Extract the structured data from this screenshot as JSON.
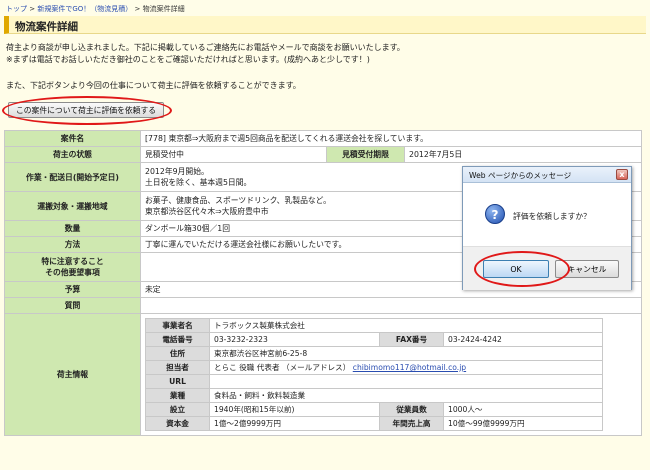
{
  "breadcrumb": {
    "items": [
      "トップ",
      "新規案件でGO！（物流見積）",
      "物流案件詳細"
    ],
    "separator": ">"
  },
  "page_title": "物流案件詳細",
  "intro": {
    "line1": "荷主より商談が申し込まれました。下記に掲載しているご連絡先にお電話やメールで商談をお願いいたします。",
    "line2": "※まずは電話でお話しいただき御社のことをご確認いただければと思います。(成約へあと少しです！)",
    "line3": "また、下記ボタンより今回の仕事について荷主に評価を依頼することができます。"
  },
  "request_button": "この案件について荷主に評価を依頼する",
  "details": {
    "case_name_label": "案件名",
    "case_name": "[778] 東京都⇒大阪府まで週5回商品を配送してくれる運送会社を探しています。",
    "status_label": "荷主の状態",
    "status": "見積受付中",
    "deadline_label": "見積受付期限",
    "deadline": "2012年7月5日",
    "work_period_label": "作業・配送日(開始予定日)",
    "work_period_1": "2012年9月開始。",
    "work_period_2": "土日祝を除く、基本週5日間。",
    "cargo_label": "運搬対象・運搬地域",
    "cargo_1": "お菓子、健康食品、スポーツドリンク、乳製品など。",
    "cargo_2": "東京都渋谷区代々木⇒大阪府豊中市",
    "quantity_label": "数量",
    "quantity": "ダンボール箱30個／1回",
    "method_label": "方法",
    "method": "丁寧に運んでいただける運送会社様にお願いしたいです。",
    "notes_label_1": "特に注意すること",
    "notes_label_2": "その他要望事項",
    "notes": "",
    "budget_label": "予算",
    "budget": "未定",
    "question_label": "質問",
    "question": "",
    "shipper_label": "荷主情報"
  },
  "shipper": {
    "company_label": "事業者名",
    "company": "トラボックス製菓株式会社",
    "phone_label": "電話番号",
    "phone": "03-3232-2323",
    "fax_label": "FAX番号",
    "fax": "03-2424-4242",
    "address_label": "住所",
    "address": "東京都渋谷区神宮前6-25-8",
    "contact_label": "担当者",
    "contact": "とらこ 役職 代表者 （メールアドレス）",
    "email": "chibimomo117@hotmail.co.jp",
    "url_label": "URL",
    "url": "",
    "industry_label": "業種",
    "industry": "食料品・飼料・飲料製造業",
    "founded_label": "設立",
    "founded": "1940年(昭和15年以前)",
    "employees_label": "従業員数",
    "employees": "1000人～",
    "capital_label": "資本金",
    "capital": "1億～2億9999万円",
    "sales_label": "年間売上高",
    "sales": "10億～99億9999万円"
  },
  "dialog": {
    "title": "Web ページからのメッセージ",
    "message": "評価を依頼しますか？",
    "ok": "OK",
    "cancel": "キャンセル",
    "close_glyph": "x",
    "icon_glyph": "?"
  }
}
